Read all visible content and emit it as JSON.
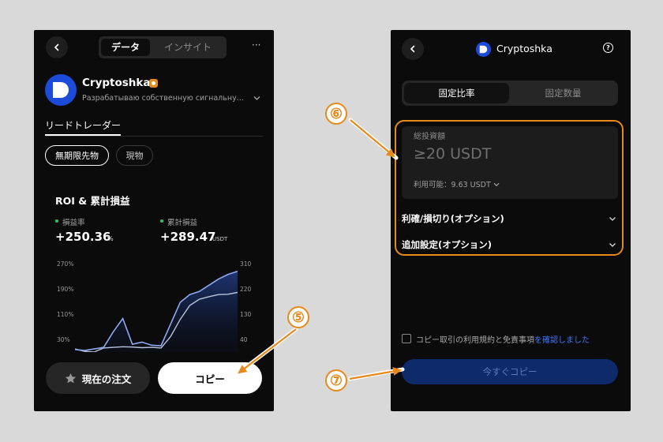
{
  "colors": {
    "accent": "#e8891c",
    "brand": "#1c4ad9",
    "positive": "#2fbf71",
    "link": "#3b78ff"
  },
  "left": {
    "tabs": [
      "データ",
      "インサイト"
    ],
    "more": "···",
    "trader": {
      "name": "Cryptoshka",
      "description": "Разрабатываю собственную сигнальну..."
    },
    "lead_tab": "リードトレーダー",
    "filters": [
      "無期限先物",
      "現物"
    ],
    "roi": {
      "title": "ROI & 累計損益",
      "rate_label": "損益率",
      "rate_value": "+250.36",
      "rate_unit": "%",
      "pnl_label": "累計損益",
      "pnl_value": "+289.47",
      "pnl_unit": "USDT"
    },
    "y_left": [
      "270%",
      "190%",
      "110%",
      "30%"
    ],
    "y_right": [
      "310",
      "220",
      "130",
      "40"
    ],
    "buttons": {
      "orders": "現在の注文",
      "copy": "コピー"
    }
  },
  "right": {
    "title": "Cryptoshka",
    "help": "?",
    "mode_tabs": [
      "固定比率",
      "固定数量"
    ],
    "investment": {
      "label": "総投資額",
      "placeholder": "≥20 USDT",
      "available": "利用可能：9.63 USDT"
    },
    "tp_sl": "利確/損切り(オプション)",
    "additional": "追加設定(オプション)",
    "agreement": {
      "text": "コピー取引の利用規約と免責事項",
      "link": "を確認しました"
    },
    "copy_now": "今すぐコピー"
  },
  "annotations": [
    "⑤",
    "⑥",
    "⑦"
  ],
  "chart_data": {
    "type": "area",
    "title": "ROI & 累計損益",
    "y_left_ticks": [
      "270%",
      "190%",
      "110%",
      "30%"
    ],
    "y_right_ticks": [
      "310",
      "220",
      "130",
      "40"
    ],
    "ylim_left": [
      -10,
      290
    ],
    "series": [
      {
        "values": [
          -2,
          -5,
          0,
          5,
          55,
          98,
          15,
          22,
          12,
          10,
          80,
          150,
          175,
          185,
          205,
          225,
          240,
          250
        ]
      },
      {
        "values": [
          0,
          -8,
          -10,
          3,
          5,
          7,
          6,
          4,
          5,
          3,
          40,
          95,
          140,
          160,
          168,
          175,
          176,
          182
        ]
      }
    ]
  }
}
